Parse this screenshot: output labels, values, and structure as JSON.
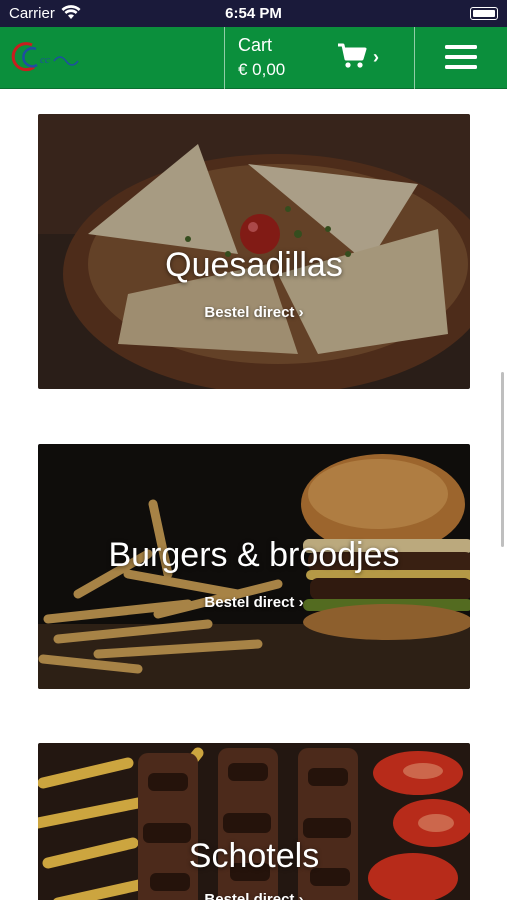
{
  "status_bar": {
    "carrier": "Carrier",
    "time": "6:54 PM"
  },
  "header": {
    "cart_label": "Cart",
    "cart_amount": "€ 0,00",
    "cart_chevron": "›",
    "brand_color": "#0b8f3c"
  },
  "icons": {
    "wifi": "wifi-icon",
    "battery": "battery-icon",
    "cart": "cart-icon",
    "menu": "hamburger-menu-icon",
    "logo": "logo-icon"
  },
  "categories": [
    {
      "title": "Quesadillas",
      "cta": "Bestel direct ›"
    },
    {
      "title": "Burgers & broodjes",
      "cta": "Bestel direct ›"
    },
    {
      "title": "Schotels",
      "cta": "Bestel direct ›"
    }
  ]
}
